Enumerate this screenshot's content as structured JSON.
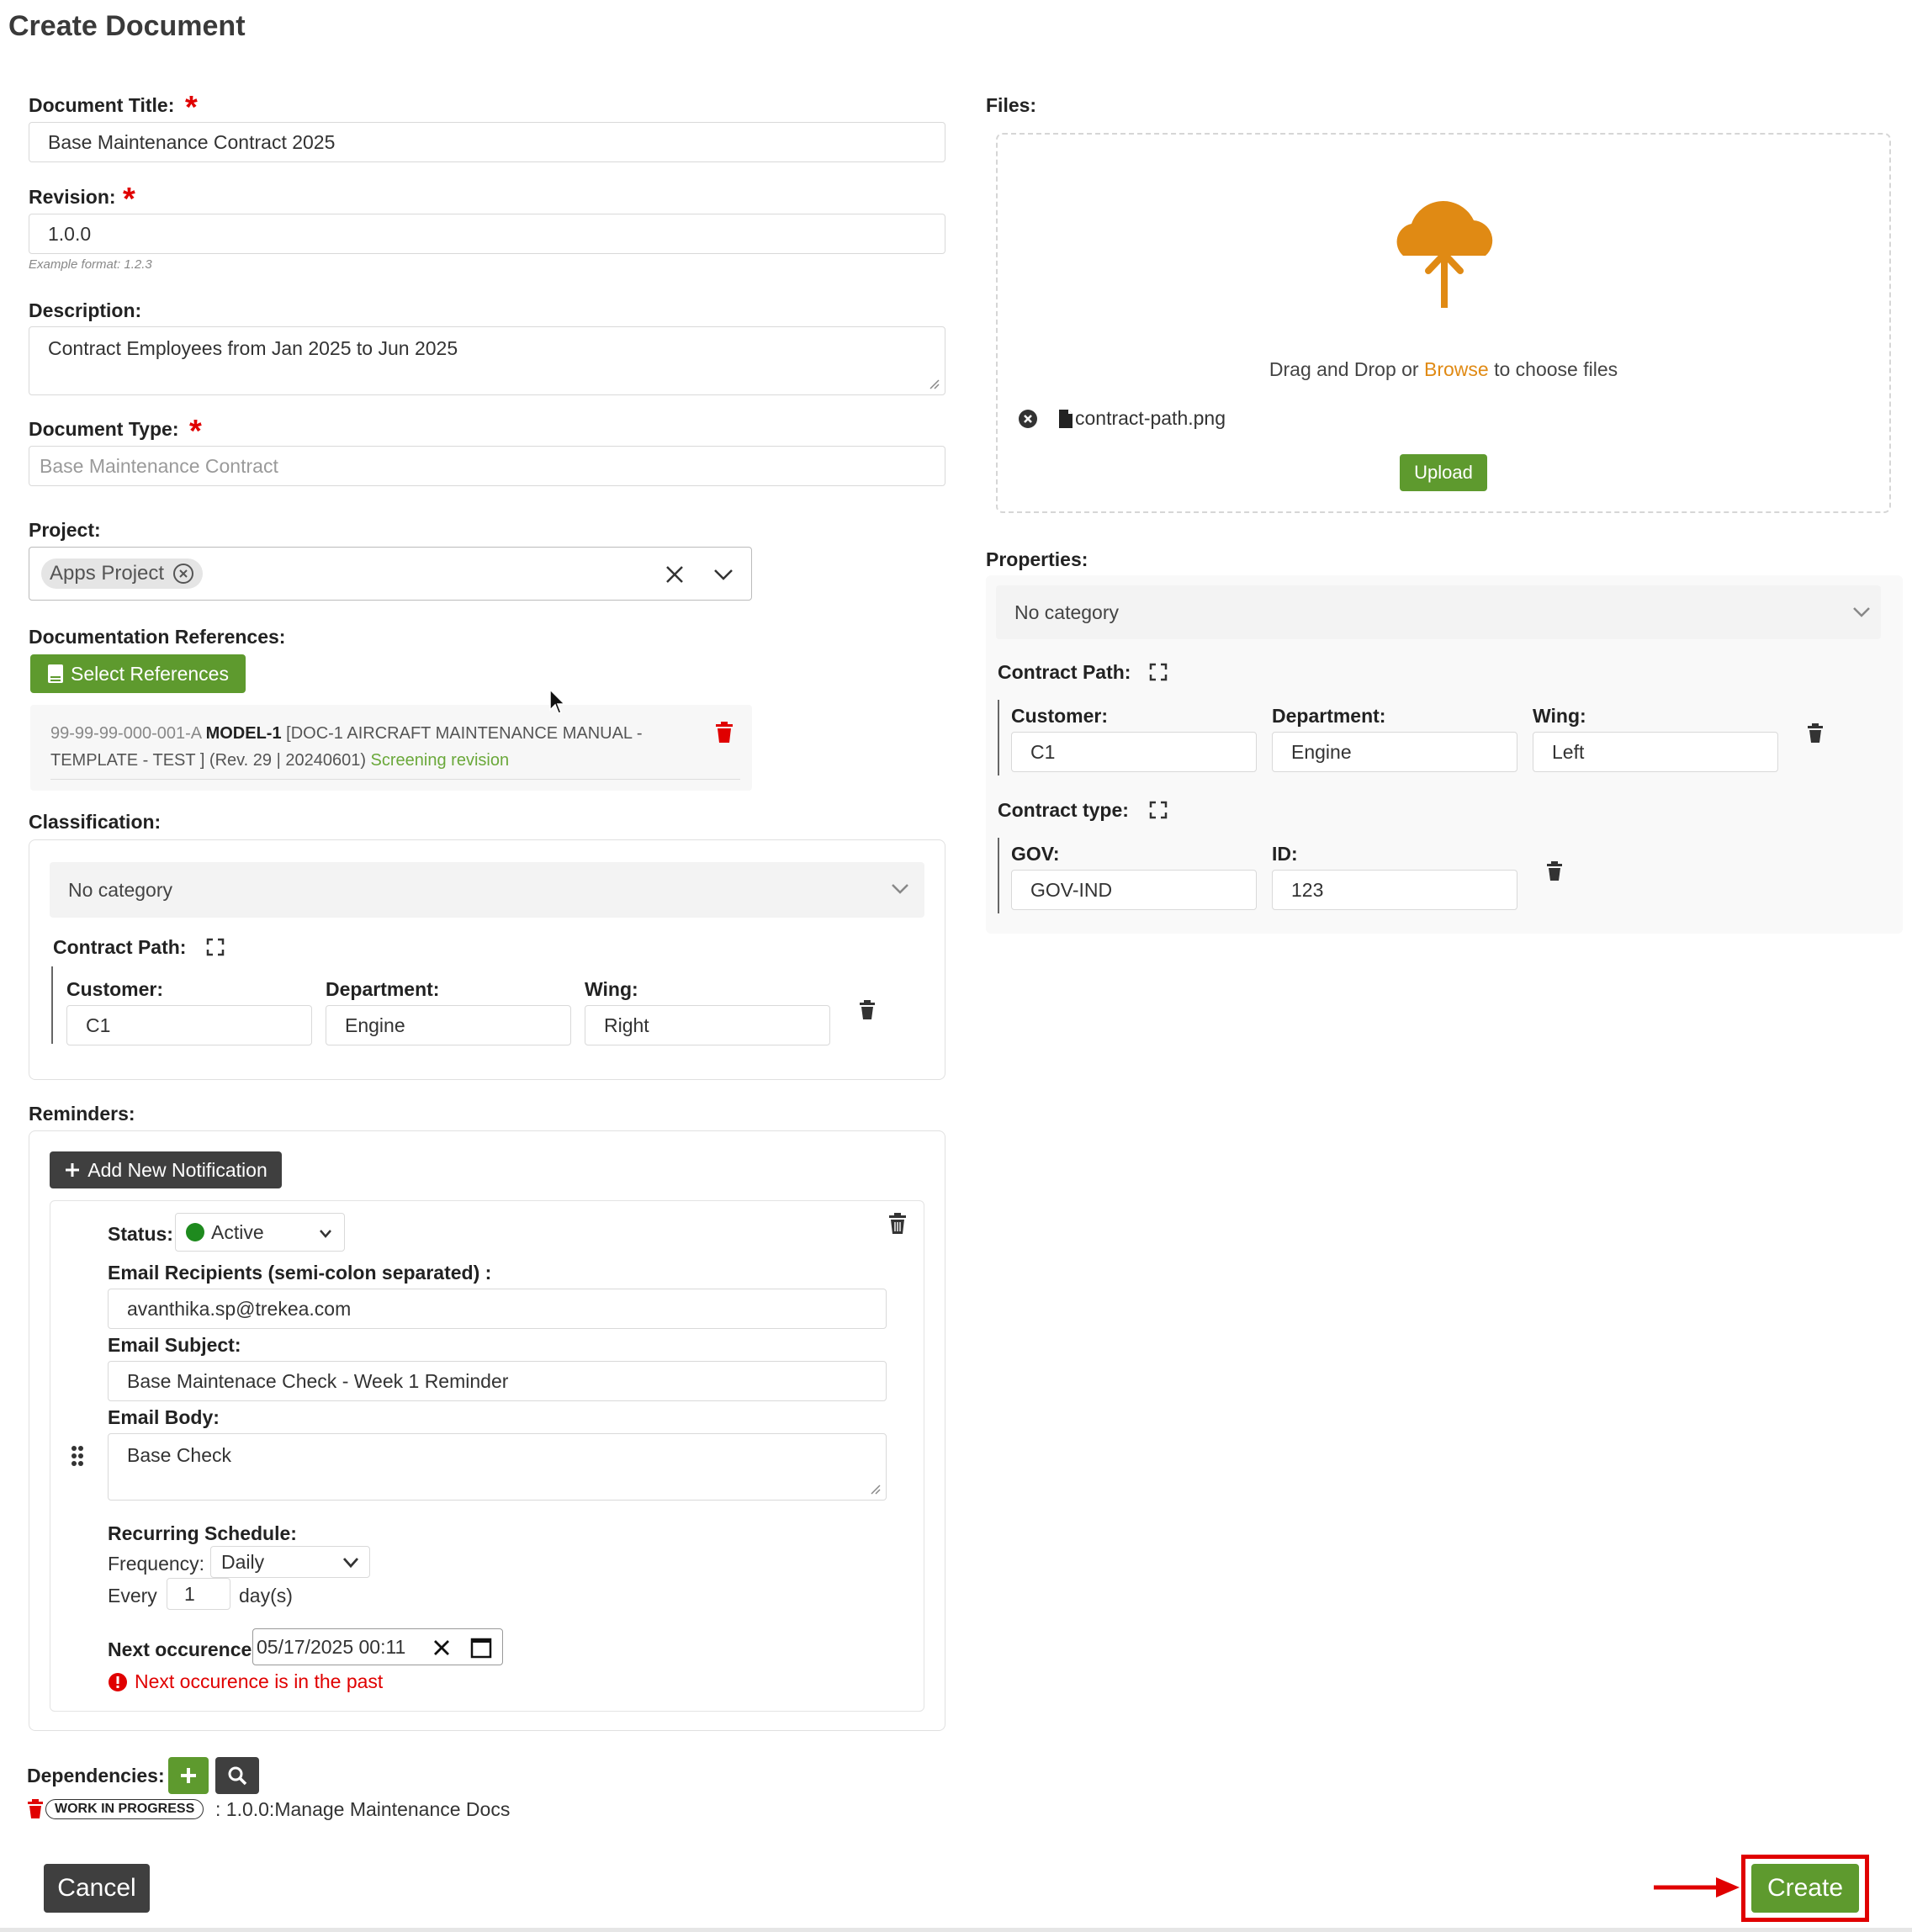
{
  "page": {
    "title": "Create Document"
  },
  "form": {
    "document_title": {
      "label": "Document Title:",
      "value": "Base Maintenance Contract 2025"
    },
    "revision": {
      "label": "Revision:",
      "value": "1.0.0",
      "hint": "Example format: 1.2.3"
    },
    "description": {
      "label": "Description:",
      "value": "Contract Employees from Jan 2025 to Jun 2025"
    },
    "document_type": {
      "label": "Document Type:",
      "placeholder": "Base Maintenance Contract"
    },
    "project": {
      "label": "Project:",
      "chip": "Apps Project"
    },
    "doc_refs": {
      "label": "Documentation References:",
      "button": "Select References",
      "item": {
        "code": "99-99-99-000-001-A",
        "model": "MODEL-1",
        "title_line1": "[DOC-1 AIRCRAFT MAINTENANCE MANUAL -",
        "title_line2": "TEMPLATE - TEST ] (Rev. 29 | 20240601)",
        "status": "Screening revision"
      }
    },
    "classification": {
      "label": "Classification:",
      "category": "No category",
      "group_label": "Contract Path:",
      "fields": [
        {
          "label": "Customer:",
          "value": "C1"
        },
        {
          "label": "Department:",
          "value": "Engine"
        },
        {
          "label": "Wing:",
          "value": "Right"
        }
      ]
    },
    "reminders": {
      "label": "Reminders:",
      "add_button": "Add New Notification",
      "status_label": "Status:",
      "status_value": "Active",
      "recipients_label": "Email Recipients (semi-colon separated) :",
      "recipients_value": "avanthika.sp@trekea.com",
      "subject_label": "Email Subject:",
      "subject_value": "Base Maintenace Check - Week 1 Reminder",
      "body_label": "Email Body:",
      "body_value": "Base Check",
      "schedule_label": "Recurring Schedule:",
      "frequency_label": "Frequency:",
      "frequency_value": "Daily",
      "every_label": "Every",
      "every_value": "1",
      "every_unit": "day(s)",
      "next_label": "Next occurence:",
      "next_value": "05/17/2025 00:11",
      "error": "Next occurence is in the past"
    },
    "dependencies": {
      "label": "Dependencies:",
      "badge": "WORK IN PROGRESS",
      "text": ": 1.0.0:Manage Maintenance Docs"
    }
  },
  "files": {
    "label": "Files:",
    "drop_text_before": "Drag and Drop or ",
    "drop_link": "Browse",
    "drop_text_after": " to choose files",
    "file_name": "contract-path.png",
    "upload_button": "Upload"
  },
  "properties": {
    "label": "Properties:",
    "category": "No category",
    "contract_path": {
      "label": "Contract Path:",
      "fields": [
        {
          "label": "Customer:",
          "value": "C1"
        },
        {
          "label": "Department:",
          "value": "Engine"
        },
        {
          "label": "Wing:",
          "value": "Left"
        }
      ]
    },
    "contract_type": {
      "label": "Contract type:",
      "fields": [
        {
          "label": "GOV:",
          "value": "GOV-IND"
        },
        {
          "label": "ID:",
          "value": "123"
        }
      ]
    }
  },
  "footer": {
    "cancel": "Cancel",
    "create": "Create"
  },
  "colors": {
    "green": "#5e9a2e",
    "orange": "#e08a14",
    "red": "#e00000",
    "dark": "#3f3f3f"
  }
}
